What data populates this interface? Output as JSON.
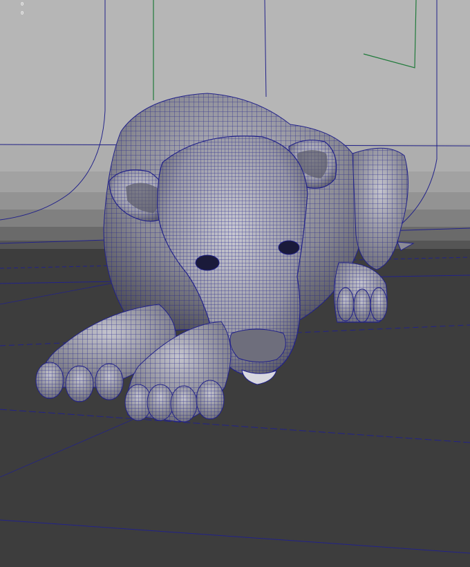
{
  "viewport": {
    "hud_values": [
      "0",
      "0"
    ],
    "colors": {
      "wire": "#22228a",
      "mesh_light": "#b6b6c0",
      "mesh_dark": "#4e4e58",
      "floor": "#3c3c3c",
      "backdrop_light": "#b2b2b2",
      "backdrop_dark": "#6c6c6c",
      "locator": "#1f7a3a"
    },
    "subject": {
      "icon": "lioness-mesh-icon",
      "pose": "lying-down-front-view"
    }
  }
}
